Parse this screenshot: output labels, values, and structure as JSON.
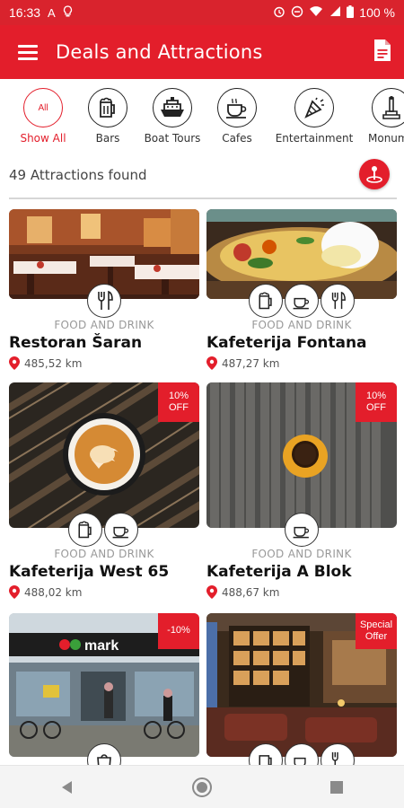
{
  "status": {
    "time": "16:33",
    "battery": "100 %"
  },
  "header": {
    "title": "Deals and Attractions"
  },
  "categories": [
    {
      "label": "Show All",
      "badge": "All",
      "icon": "all-icon",
      "active": true
    },
    {
      "label": "Bars",
      "icon": "beer-mug-icon"
    },
    {
      "label": "Boat Tours",
      "icon": "ship-icon"
    },
    {
      "label": "Cafes",
      "icon": "coffee-cup-icon"
    },
    {
      "label": "Entertainment",
      "icon": "party-popper-icon"
    },
    {
      "label": "Monume",
      "icon": "monument-icon"
    }
  ],
  "results": {
    "count_text": "49 Attractions found"
  },
  "cards": [
    {
      "name": "Restoran Šaran",
      "category": "FOOD AND DRINK",
      "distance": "485,52 km",
      "badge": "",
      "icons": [
        "cutlery-icon"
      ]
    },
    {
      "name": "Kafeterija Fontana",
      "category": "FOOD AND DRINK",
      "distance": "487,27 km",
      "badge": "",
      "icons": [
        "beer-mug-icon",
        "coffee-cup-icon",
        "cutlery-icon"
      ]
    },
    {
      "name": "Kafeterija West 65",
      "category": "FOOD AND DRINK",
      "distance": "488,02 km",
      "badge": "10% OFF",
      "icons": [
        "beer-mug-icon",
        "coffee-cup-icon"
      ]
    },
    {
      "name": "Kafeterija A Blok",
      "category": "FOOD AND DRINK",
      "distance": "488,67 km",
      "badge": "10% OFF",
      "icons": [
        "coffee-cup-icon"
      ]
    },
    {
      "name": "",
      "category": "",
      "distance": "",
      "badge": "-10%",
      "sign_text": "mark",
      "icons": [
        "shopping-icon"
      ]
    },
    {
      "name": "",
      "category": "",
      "distance": "",
      "badge": "Special Offer",
      "icons": [
        "beer-mug-icon",
        "coffee-cup-icon",
        "cutlery-icon"
      ]
    }
  ],
  "colors": {
    "brand": "#e31e2b",
    "status_bar": "#d9232d"
  }
}
